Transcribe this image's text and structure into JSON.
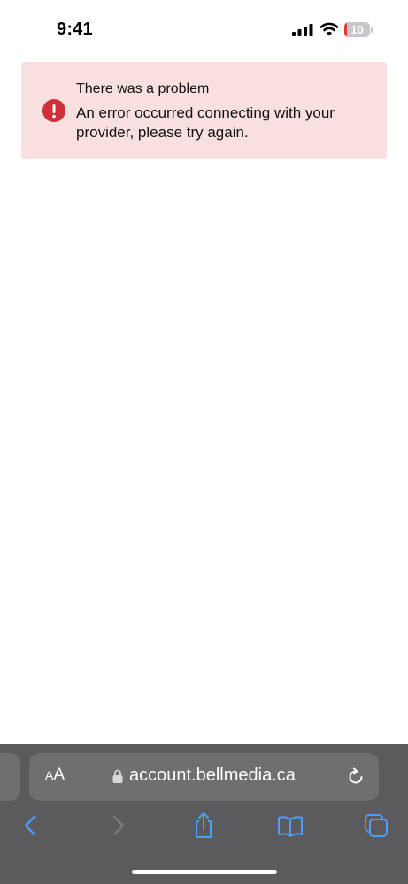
{
  "status_bar": {
    "time": "9:41",
    "battery_level": "10",
    "battery_fraction": 0.1,
    "battery_color": "#e53935",
    "icons": [
      "signal-icon",
      "wifi-icon",
      "battery-icon"
    ]
  },
  "error": {
    "title": "There was a problem",
    "message": "An error occurred connecting with your provider, please try again.",
    "icon": "exclamation-circle-icon",
    "background_color": "#f8e0e0",
    "icon_color": "#d03037"
  },
  "browser": {
    "reader_small": "A",
    "reader_large": "A",
    "url": "account.bellmedia.ca",
    "icons": [
      "lock-icon",
      "reload-icon",
      "back-icon",
      "forward-icon",
      "share-icon",
      "bookmarks-icon",
      "tabs-icon"
    ],
    "accent_color": "#4a9eff"
  }
}
